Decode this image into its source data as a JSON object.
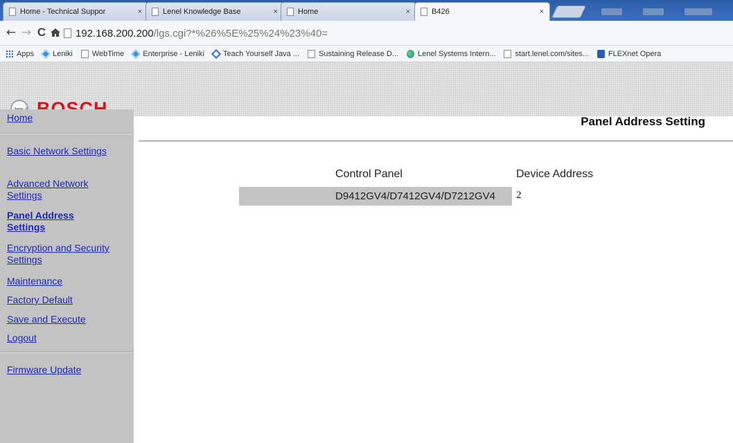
{
  "browser": {
    "tabs": [
      {
        "title": "Home - Technical Suppor",
        "close": "×"
      },
      {
        "title": "Lenel Knowledge Base",
        "close": "×"
      },
      {
        "title": "Home",
        "close": "×"
      },
      {
        "title": "B426",
        "close": "×",
        "active": true
      }
    ],
    "nav": {
      "back": "←",
      "forward": "→",
      "reload": "C",
      "home": "ft"
    },
    "address": {
      "host": "192.168.200.200",
      "path": "/lgs.cgi?*%26%5E%25%24%23%40="
    },
    "bookmarks": [
      {
        "label": "Apps",
        "icon": "apps-icon"
      },
      {
        "label": "Leniki",
        "icon": "diamond-icon"
      },
      {
        "label": "WebTime",
        "icon": "page-icon"
      },
      {
        "label": "Enterprise - Leniki",
        "icon": "diamond-icon"
      },
      {
        "label": "Teach Yourself Java ...",
        "icon": "diamond-outline-icon"
      },
      {
        "label": "Sustaining Release D...",
        "icon": "page-icon"
      },
      {
        "label": "Lenel Systems Intern...",
        "icon": "globe-icon"
      },
      {
        "label": "start.lenel.com/sites...",
        "icon": "page-icon"
      },
      {
        "label": "FLEXnet Opera",
        "icon": "flexnet-icon"
      }
    ]
  },
  "page": {
    "logo": "BOSCH",
    "brand_color": "#d4141e",
    "sidebar": {
      "home": "Home",
      "basic_network": "Basic Network Settings",
      "advanced_network": "Advanced Network Settings",
      "panel_address": "Panel Address Settings",
      "encryption": "Encryption and Security Settings",
      "maintenance": "Maintenance",
      "factory_default": "Factory Default",
      "save_execute": "Save and Execute",
      "logout": "Logout",
      "firmware_update": "Firmware Update"
    },
    "title": "Panel Address Setting",
    "table": {
      "headers": [
        "Control Panel",
        "Device Address"
      ],
      "rows": [
        {
          "control_panel": "D9412GV4/D7412GV4/D7212GV4",
          "device_address": "2"
        }
      ]
    }
  }
}
